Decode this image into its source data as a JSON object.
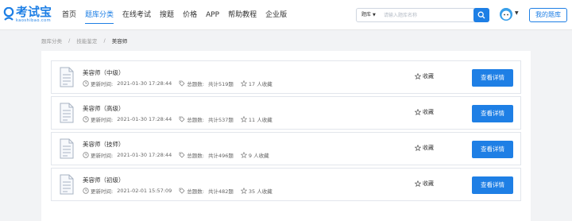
{
  "header": {
    "logo_text": "考试宝",
    "logo_sub": "kaoshibao.com",
    "nav": [
      {
        "label": "首页",
        "active": false
      },
      {
        "label": "题库分类",
        "active": true
      },
      {
        "label": "在线考试",
        "active": false
      },
      {
        "label": "搜题",
        "active": false
      },
      {
        "label": "价格",
        "active": false
      },
      {
        "label": "APP",
        "active": false
      },
      {
        "label": "帮助教程",
        "active": false
      },
      {
        "label": "企业版",
        "active": false
      }
    ],
    "search_type": "题库",
    "search_placeholder": "请输入题库名称",
    "my_bank": "我的题库"
  },
  "breadcrumb": {
    "items": [
      "题库分类",
      "技能鉴定",
      "美容师"
    ],
    "separator": "/"
  },
  "labels": {
    "update_time": "更新时间:",
    "total_questions": "总题数:",
    "favorite": "收藏",
    "view_detail": "查看详情"
  },
  "rows": [
    {
      "title": "美容师（中级）",
      "time": "2021-01-30 17:28:44",
      "total": "共计519题",
      "favs": "17 人收藏"
    },
    {
      "title": "美容师（高级）",
      "time": "2021-01-30 17:28:44",
      "total": "共计537题",
      "favs": "11 人收藏"
    },
    {
      "title": "美容师（技师）",
      "time": "2021-01-30 17:28:44",
      "total": "共计496题",
      "favs": "9 人收藏"
    },
    {
      "title": "美容师（初级）",
      "time": "2021-02-01 15:57:09",
      "total": "共计482题",
      "favs": "35 人收藏"
    }
  ],
  "colors": {
    "accent": "#1e7fe5",
    "page_bg": "#f2f3f5"
  }
}
